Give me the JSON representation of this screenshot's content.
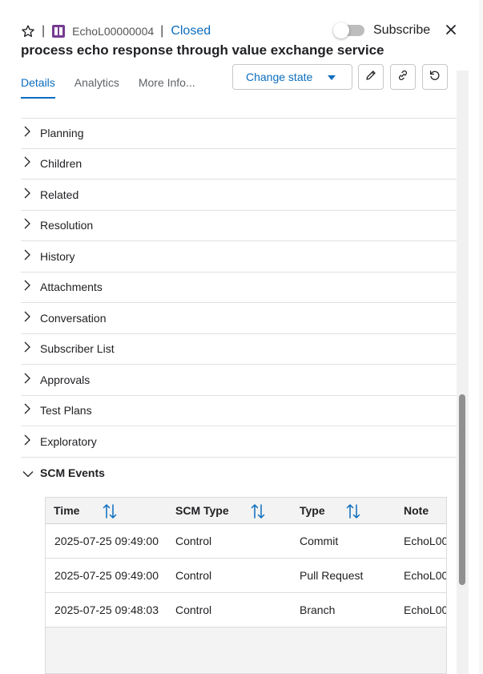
{
  "header": {
    "separator": "|",
    "work_item_id": "EchoL00000004",
    "state": "Closed",
    "subscribe_label": "Subscribe",
    "title": "process echo response through value exchange service"
  },
  "tabs": [
    {
      "label": "Details",
      "active": true
    },
    {
      "label": "Analytics",
      "active": false
    },
    {
      "label": "More Info...",
      "active": false
    }
  ],
  "toolbar": {
    "change_state_label": "Change state"
  },
  "sections": [
    {
      "label": "Planning"
    },
    {
      "label": "Children"
    },
    {
      "label": "Related"
    },
    {
      "label": "Resolution"
    },
    {
      "label": "History"
    },
    {
      "label": "Attachments"
    },
    {
      "label": "Conversation"
    },
    {
      "label": "Subscriber List"
    },
    {
      "label": "Approvals"
    },
    {
      "label": "Test Plans"
    },
    {
      "label": "Exploratory"
    }
  ],
  "scm_events": {
    "label": "SCM Events",
    "columns": [
      "Time",
      "SCM Type",
      "Type",
      "Note"
    ],
    "rows": [
      {
        "time": "2025-07-25 09:49:00",
        "scm_type": "Control",
        "type": "Commit",
        "note": "EchoL00"
      },
      {
        "time": "2025-07-25 09:49:00",
        "scm_type": "Control",
        "type": "Pull Request",
        "note": "EchoL00"
      },
      {
        "time": "2025-07-25 09:48:03",
        "scm_type": "Control",
        "type": "Branch",
        "note": "EchoL00"
      }
    ]
  },
  "colors": {
    "accent": "#0b6dbf",
    "work_item_icon": "#773b93"
  },
  "icons": {
    "favorite": "star-icon",
    "work_item": "work-item-icon",
    "close": "close-icon",
    "edit": "pencil-icon",
    "copy_link": "link-icon",
    "refresh": "refresh-icon",
    "collapsed": "chevron-right-icon",
    "expanded": "chevron-down-icon",
    "sort": "sort-icon"
  }
}
